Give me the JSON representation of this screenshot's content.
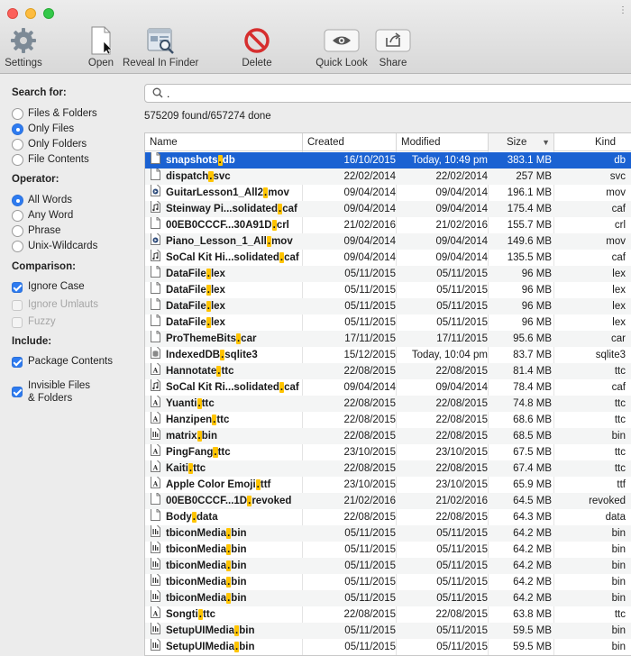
{
  "window": {
    "menu_glyph": "⋮"
  },
  "toolbar": {
    "settings": "Settings",
    "open": "Open",
    "reveal": "Reveal In Finder",
    "delete": "Delete",
    "quicklook": "Quick Look",
    "share": "Share"
  },
  "sidebar": {
    "search_for": {
      "title": "Search for:",
      "options": [
        "Files & Folders",
        "Only Files",
        "Only Folders",
        "File Contents"
      ],
      "selected": "Only Files"
    },
    "operator": {
      "title": "Operator:",
      "options": [
        "All Words",
        "Any Word",
        "Phrase",
        "Unix-Wildcards"
      ],
      "selected": "All Words"
    },
    "comparison": {
      "title": "Comparison:",
      "ignore_case": "Ignore Case",
      "ignore_umlauts": "Ignore Umlauts",
      "fuzzy": "Fuzzy"
    },
    "include": {
      "title": "Include:",
      "package_contents": "Package Contents",
      "invisible_line1": "Invisible Files",
      "invisible_line2": "& Folders"
    }
  },
  "search": {
    "value": "."
  },
  "status": "575209 found/657274 done",
  "columns": {
    "name": "Name",
    "created": "Created",
    "modified": "Modified",
    "size": "Size",
    "kind": "Kind",
    "sort_indicator": "▼"
  },
  "rows": [
    {
      "pre": "snapshots",
      "hl": ".",
      "post": "db",
      "created": "16/10/2015",
      "modified": "Today, 10:49 pm",
      "size": "383.1 MB",
      "kind": "db",
      "icon": "doc"
    },
    {
      "pre": "dispatch",
      "hl": ".",
      "post": "svc",
      "created": "22/02/2014",
      "modified": "22/02/2014",
      "size": "257 MB",
      "kind": "svc",
      "icon": "doc"
    },
    {
      "pre": "GuitarLesson1_All2",
      "hl": ".",
      "post": "mov",
      "created": "09/04/2014",
      "modified": "09/04/2014",
      "size": "196.1 MB",
      "kind": "mov",
      "icon": "movie"
    },
    {
      "pre": "Steinway Pi...solidated",
      "hl": ".",
      "post": "caf",
      "created": "09/04/2014",
      "modified": "09/04/2014",
      "size": "175.4 MB",
      "kind": "caf",
      "icon": "audio"
    },
    {
      "pre": "00EB0CCCF...30A91D",
      "hl": ".",
      "post": "crl",
      "created": "21/02/2016",
      "modified": "21/02/2016",
      "size": "155.7 MB",
      "kind": "crl",
      "icon": "doc"
    },
    {
      "pre": "Piano_Lesson_1_All",
      "hl": ".",
      "post": "mov",
      "created": "09/04/2014",
      "modified": "09/04/2014",
      "size": "149.6 MB",
      "kind": "mov",
      "icon": "movie"
    },
    {
      "pre": "SoCal Kit Hi...solidated",
      "hl": ".",
      "post": "caf",
      "created": "09/04/2014",
      "modified": "09/04/2014",
      "size": "135.5 MB",
      "kind": "caf",
      "icon": "audio"
    },
    {
      "pre": "DataFile",
      "hl": ".",
      "post": "lex",
      "created": "05/11/2015",
      "modified": "05/11/2015",
      "size": "96 MB",
      "kind": "lex",
      "icon": "doc"
    },
    {
      "pre": "DataFile",
      "hl": ".",
      "post": "lex",
      "created": "05/11/2015",
      "modified": "05/11/2015",
      "size": "96 MB",
      "kind": "lex",
      "icon": "doc"
    },
    {
      "pre": "DataFile",
      "hl": ".",
      "post": "lex",
      "created": "05/11/2015",
      "modified": "05/11/2015",
      "size": "96 MB",
      "kind": "lex",
      "icon": "doc"
    },
    {
      "pre": "DataFile",
      "hl": ".",
      "post": "lex",
      "created": "05/11/2015",
      "modified": "05/11/2015",
      "size": "96 MB",
      "kind": "lex",
      "icon": "doc"
    },
    {
      "pre": "ProThemeBits",
      "hl": ".",
      "post": "car",
      "created": "17/11/2015",
      "modified": "17/11/2015",
      "size": "95.6 MB",
      "kind": "car",
      "icon": "doc"
    },
    {
      "pre": "IndexedDB",
      "hl": ".",
      "post": "sqlite3",
      "created": "15/12/2015",
      "modified": "Today, 10:04 pm",
      "size": "83.7 MB",
      "kind": "sqlite3",
      "icon": "db"
    },
    {
      "pre": "Hannotate",
      "hl": ".",
      "post": "ttc",
      "created": "22/08/2015",
      "modified": "22/08/2015",
      "size": "81.4 MB",
      "kind": "ttc",
      "icon": "font"
    },
    {
      "pre": "SoCal Kit Ri...solidated",
      "hl": ".",
      "post": "caf",
      "created": "09/04/2014",
      "modified": "09/04/2014",
      "size": "78.4 MB",
      "kind": "caf",
      "icon": "audio"
    },
    {
      "pre": "Yuanti",
      "hl": ".",
      "post": "ttc",
      "created": "22/08/2015",
      "modified": "22/08/2015",
      "size": "74.8 MB",
      "kind": "ttc",
      "icon": "font"
    },
    {
      "pre": "Hanzipen",
      "hl": ".",
      "post": "ttc",
      "created": "22/08/2015",
      "modified": "22/08/2015",
      "size": "68.6 MB",
      "kind": "ttc",
      "icon": "font"
    },
    {
      "pre": "matrix",
      "hl": ".",
      "post": "bin",
      "created": "22/08/2015",
      "modified": "22/08/2015",
      "size": "68.5 MB",
      "kind": "bin",
      "icon": "bin"
    },
    {
      "pre": "PingFang",
      "hl": ".",
      "post": "ttc",
      "created": "23/10/2015",
      "modified": "23/10/2015",
      "size": "67.5 MB",
      "kind": "ttc",
      "icon": "font"
    },
    {
      "pre": "Kaiti",
      "hl": ".",
      "post": "ttc",
      "created": "22/08/2015",
      "modified": "22/08/2015",
      "size": "67.4 MB",
      "kind": "ttc",
      "icon": "font"
    },
    {
      "pre": "Apple Color Emoji",
      "hl": ".",
      "post": "ttf",
      "created": "23/10/2015",
      "modified": "23/10/2015",
      "size": "65.9 MB",
      "kind": "ttf",
      "icon": "font"
    },
    {
      "pre": "00EB0CCCF...1D",
      "hl": ".",
      "post": "revoked",
      "created": "21/02/2016",
      "modified": "21/02/2016",
      "size": "64.5 MB",
      "kind": "revoked",
      "icon": "doc"
    },
    {
      "pre": "Body",
      "hl": ".",
      "post": "data",
      "created": "22/08/2015",
      "modified": "22/08/2015",
      "size": "64.3 MB",
      "kind": "data",
      "icon": "doc"
    },
    {
      "pre": "tbiconMedia",
      "hl": ".",
      "post": "bin",
      "created": "05/11/2015",
      "modified": "05/11/2015",
      "size": "64.2 MB",
      "kind": "bin",
      "icon": "bin"
    },
    {
      "pre": "tbiconMedia",
      "hl": ".",
      "post": "bin",
      "created": "05/11/2015",
      "modified": "05/11/2015",
      "size": "64.2 MB",
      "kind": "bin",
      "icon": "bin"
    },
    {
      "pre": "tbiconMedia",
      "hl": ".",
      "post": "bin",
      "created": "05/11/2015",
      "modified": "05/11/2015",
      "size": "64.2 MB",
      "kind": "bin",
      "icon": "bin"
    },
    {
      "pre": "tbiconMedia",
      "hl": ".",
      "post": "bin",
      "created": "05/11/2015",
      "modified": "05/11/2015",
      "size": "64.2 MB",
      "kind": "bin",
      "icon": "bin"
    },
    {
      "pre": "tbiconMedia",
      "hl": ".",
      "post": "bin",
      "created": "05/11/2015",
      "modified": "05/11/2015",
      "size": "64.2 MB",
      "kind": "bin",
      "icon": "bin"
    },
    {
      "pre": "Songti",
      "hl": ".",
      "post": "ttc",
      "created": "22/08/2015",
      "modified": "22/08/2015",
      "size": "63.8 MB",
      "kind": "ttc",
      "icon": "font"
    },
    {
      "pre": "SetupUIMedia",
      "hl": ".",
      "post": "bin",
      "created": "05/11/2015",
      "modified": "05/11/2015",
      "size": "59.5 MB",
      "kind": "bin",
      "icon": "bin"
    },
    {
      "pre": "SetupUIMedia",
      "hl": ".",
      "post": "bin",
      "created": "05/11/2015",
      "modified": "05/11/2015",
      "size": "59.5 MB",
      "kind": "bin",
      "icon": "bin"
    }
  ],
  "selected_row": 0,
  "colors": {
    "accent": "#1b62d2",
    "highlight": "#ffc400"
  }
}
